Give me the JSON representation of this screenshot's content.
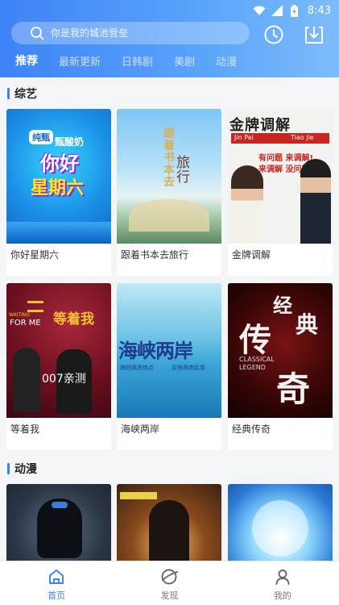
{
  "status_bar": {
    "time": "8:43",
    "wifi_icon": "wifi-icon",
    "signal_icon": "signal-icon",
    "battery_icon": "battery-icon"
  },
  "search": {
    "placeholder": "你是我的城池营垒"
  },
  "tabs": [
    {
      "label": "推荐",
      "active": true
    },
    {
      "label": "最新更新",
      "active": false
    },
    {
      "label": "日韩剧",
      "active": false
    },
    {
      "label": "美剧",
      "active": false
    },
    {
      "label": "动漫",
      "active": false
    }
  ],
  "sections": [
    {
      "title": "综艺",
      "items": [
        {
          "title": "你好星期六",
          "poster_text": [
            "纯甄",
            "甄酸奶",
            "你好",
            "星期六"
          ]
        },
        {
          "title": "跟着书本去旅行",
          "poster_text": [
            "跟着书本去",
            "旅行"
          ]
        },
        {
          "title": "金牌调解",
          "poster_text": [
            "金牌调解",
            "Jin Pai",
            "Tiao Jie",
            "有问题 来调解!",
            "来调解 没问题!"
          ]
        },
        {
          "title": "等着我",
          "poster_text": [
            "等着我",
            "WAITING",
            "FOR ME",
            "007亲测"
          ]
        },
        {
          "title": "海峡两岸",
          "poster_text": [
            "海峡两岸",
            "跟踪两岸热点",
            "反映两岸民意"
          ]
        },
        {
          "title": "经典传奇",
          "poster_text": [
            "经",
            "典",
            "传",
            "奇",
            "CLASSICAL",
            "LEGEND"
          ]
        }
      ]
    },
    {
      "title": "动漫",
      "items": [
        {
          "title": ""
        },
        {
          "title": ""
        },
        {
          "title": ""
        }
      ]
    }
  ],
  "bottom_nav": [
    {
      "label": "首页",
      "icon": "home-icon",
      "active": true
    },
    {
      "label": "发现",
      "icon": "discover-icon",
      "active": false
    },
    {
      "label": "我的",
      "icon": "profile-icon",
      "active": false
    }
  ],
  "colors": {
    "accent": "#3b80f6",
    "header_start": "#3e83f6",
    "header_end": "#7dbcfb",
    "background": "#f4f5f7"
  }
}
